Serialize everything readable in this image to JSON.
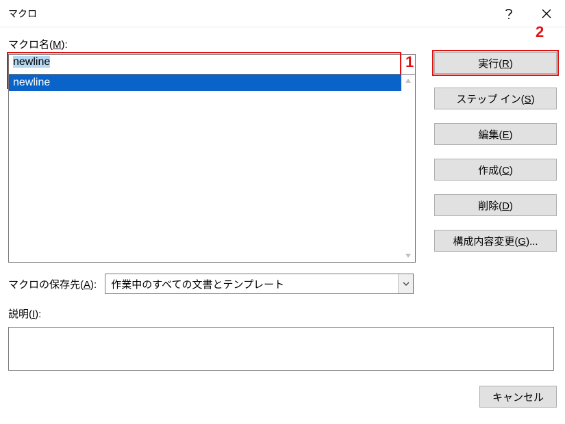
{
  "title": "マクロ",
  "labels": {
    "macro_name": "マクロ名(",
    "macro_name_key": "M",
    "macro_name_suffix": "):",
    "macro_location": "マクロの保存先(",
    "macro_location_key": "A",
    "macro_location_suffix": "):",
    "description": "説明(",
    "description_key": "I",
    "description_suffix": "):"
  },
  "macro_name_value": "newline",
  "macro_list": [
    "newline"
  ],
  "macro_location_value": "作業中のすべての文書とテンプレート",
  "buttons": {
    "run": {
      "text": "実行(",
      "key": "R",
      "suffix": ")"
    },
    "step_in": {
      "text": "ステップ イン(",
      "key": "S",
      "suffix": ")"
    },
    "edit": {
      "text": "編集(",
      "key": "E",
      "suffix": ")"
    },
    "create": {
      "text": "作成(",
      "key": "C",
      "suffix": ")"
    },
    "delete": {
      "text": "削除(",
      "key": "D",
      "suffix": ")"
    },
    "organizer": {
      "text": "構成内容変更(",
      "key": "G",
      "suffix": ")..."
    },
    "cancel": "キャンセル"
  },
  "annotations": {
    "a1": "1",
    "a2": "2"
  }
}
